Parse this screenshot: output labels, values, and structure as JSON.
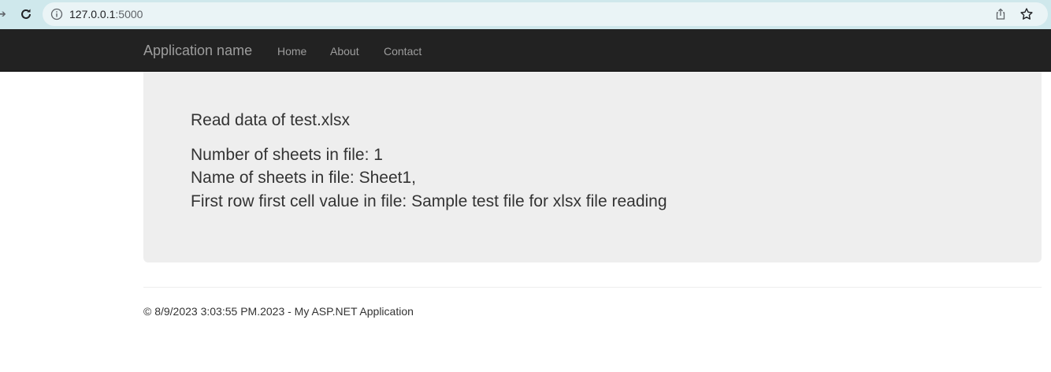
{
  "browser": {
    "url_host": "127.0.0.1",
    "url_port": ":5000",
    "icons": {
      "forward": "forward-arrow-icon",
      "reload": "reload-icon",
      "info": "site-info-icon",
      "share": "share-icon",
      "bookmark": "bookmark-star-icon"
    }
  },
  "navbar": {
    "brand": "Application name",
    "links": [
      "Home",
      "About",
      "Contact"
    ],
    "background": "#222222",
    "link_color": "#9d9d9d"
  },
  "jumbotron": {
    "title": "Read data of test.xlsx",
    "lines": [
      "Number of sheets in file: 1",
      "Name of sheets in file: Sheet1,",
      "First row first cell value in file: Sample test file for xlsx file reading"
    ],
    "background": "#eeeeee"
  },
  "footer": {
    "text": "© 8/9/2023 3:03:55 PM.2023 - My ASP.NET Application"
  }
}
